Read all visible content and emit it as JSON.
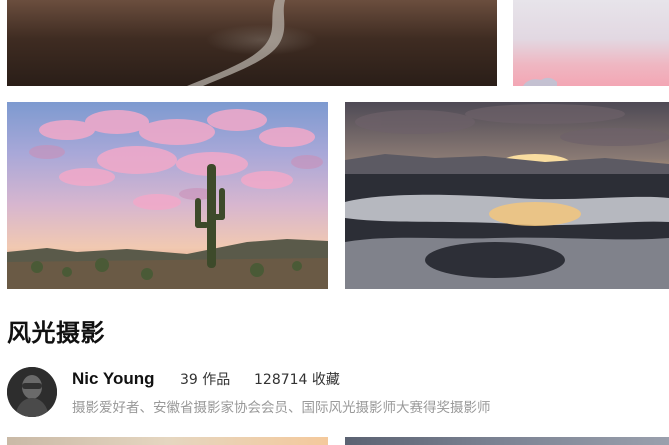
{
  "gallery": {
    "section_title": "风光摄影",
    "photos": [
      {
        "name": "dark-river-valley-photo",
        "alt": "river valley landscape"
      },
      {
        "name": "pink-sky-photo",
        "alt": "pink sky landscape"
      },
      {
        "name": "saguaro-cactus-sunset-photo",
        "alt": "saguaro cactus under pink clouds"
      },
      {
        "name": "sunset-reflection-lake-photo",
        "alt": "sunset reflected on lake"
      },
      {
        "name": "bottom-left-photo",
        "alt": "landscape"
      },
      {
        "name": "bottom-right-photo",
        "alt": "landscape"
      }
    ]
  },
  "author": {
    "name": "Nic Young",
    "works": "39 作品",
    "favorites": "128714 收藏",
    "bio": "摄影爱好者、安徽省摄影家协会会员、国际风光摄影师大赛得奖摄影师"
  },
  "colors": {
    "background": "#ffffff",
    "title": "#111111",
    "meta_text": "#333333",
    "bio_text": "#999999"
  }
}
